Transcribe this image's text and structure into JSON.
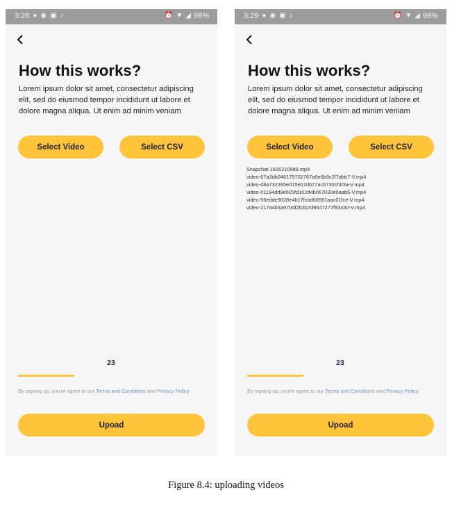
{
  "screens": [
    {
      "id": "left",
      "status": {
        "time": "3:28",
        "battery": "98%"
      },
      "title": "How this works?",
      "description": "Lorem ipsum dolor sit amet, consectetur adipiscing elit, sed do eiusmod tempor incididunt ut labore et dolore magna aliqua. Ut enim ad minim veniam",
      "select_video_label": "Select Video",
      "select_csv_label": "Select CSV",
      "files": [],
      "count": "23",
      "progress": 0.3,
      "terms": {
        "prefix": "By signing up, you're agree to our ",
        "terms_link": "Terms and Conditions",
        "and": " and ",
        "privacy_link": "Privacy Policy",
        "suffix": "."
      },
      "upload_label": "Upoad"
    },
    {
      "id": "right",
      "status": {
        "time": "3:29",
        "battery": "98%"
      },
      "title": "How this works?",
      "description": "Lorem ipsum dolor sit amet, consectetur adipiscing elit, sed do eiusmod tempor incididunt ut labore et dolore magna aliqua. Ut enim ad minim veniam",
      "select_video_label": "Select Video",
      "select_csv_label": "Select CSV",
      "files": [
        "Snapchat-1835210989.mp4",
        "video-67a3db048179702767a0e0b9c2f7dbb7-V.mp4",
        "video-d8a732395e015eb7d677ac6730cf3f3a-V.mp4",
        "video-01194dd9e025fd102d4b067030e0aab5-V.mp4",
        "video-56edde9028e4b17fcbd68561aac01fce-V.mp4",
        "video-217a4b3a970df2b3b7d9647277f93450-V.mp4"
      ],
      "count": "23",
      "progress": 0.3,
      "terms": {
        "prefix": "By signing up, you're agree to our ",
        "terms_link": "Terms and Conditions",
        "and": " and ",
        "privacy_link": "Privacy Policy",
        "suffix": "."
      },
      "upload_label": "Upoad"
    }
  ],
  "caption": "Figure 8.4: uploading videos",
  "colors": {
    "accent": "#ffc43a",
    "link": "#6f8fd0",
    "status_bar": "#9c9c9c"
  },
  "icons": {
    "status_left": [
      "snapchat-icon",
      "messenger-icon",
      "instagram-icon",
      "tiktok-icon"
    ],
    "status_right": [
      "alarm-icon",
      "wifi-icon",
      "signal-icon"
    ],
    "back": "chevron-left-icon"
  }
}
